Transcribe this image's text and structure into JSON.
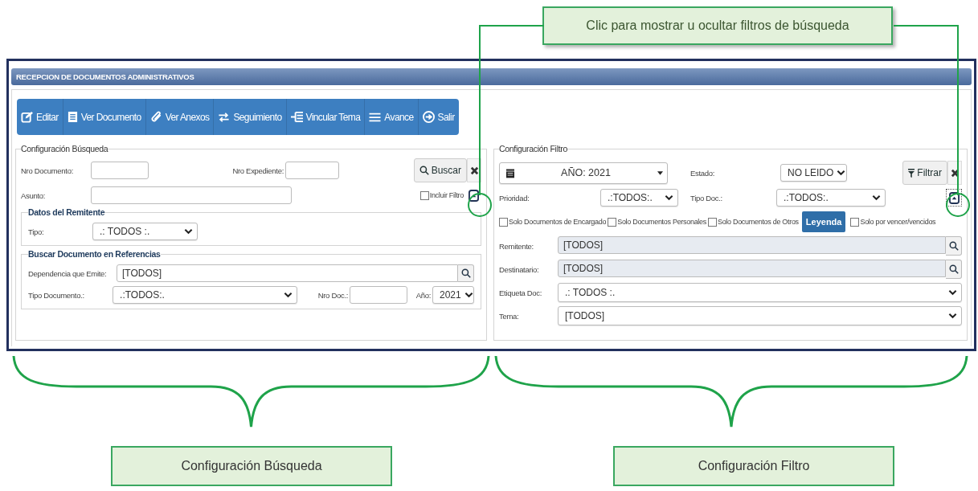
{
  "callout": {
    "text": "Clic para mostrar u ocultar filtros de búsqueda"
  },
  "window": {
    "title": "RECEPCION DE DOCUMENTOS ADMINISTRATIVOS"
  },
  "toolbar": [
    {
      "kind": "edit",
      "label": "Editar"
    },
    {
      "kind": "document",
      "label": "Ver Documento"
    },
    {
      "kind": "paperclip",
      "label": "Ver Anexos"
    },
    {
      "kind": "swap",
      "label": "Seguimiento"
    },
    {
      "kind": "link",
      "label": "Vincular Tema"
    },
    {
      "kind": "list",
      "label": "Avance"
    },
    {
      "kind": "exit",
      "label": "Salir"
    }
  ],
  "search_panel": {
    "legend": "Configuración Búsqueda",
    "nro_documento": {
      "label": "Nro Documento:"
    },
    "nro_expediente": {
      "label": "Nro Expediente:"
    },
    "search_button": {
      "label": "Buscar"
    },
    "asunto": {
      "label": "Asunto:"
    },
    "incluir_filtro": {
      "label": "Incluir Filtro",
      "checked": false
    },
    "remitente_group": {
      "legend": "Datos del Remitente",
      "tipo": {
        "label": "Tipo:",
        "value": ".: TODOS :."
      }
    },
    "referencias_group": {
      "legend": "Buscar Documento en Referencias",
      "dependencia": {
        "label": "Dependencia que Emite:",
        "value": "[TODOS]"
      },
      "tipo_documento": {
        "label": "Tipo Documento.:",
        "value": ".:TODOS:."
      },
      "nro_doc": {
        "label": "Nro Doc.:"
      },
      "anio": {
        "label": "Año:",
        "value": "2021"
      }
    }
  },
  "filter_panel": {
    "legend": "Configuración Filtro",
    "year": {
      "value": "AÑO: 2021"
    },
    "estado": {
      "label": "Estado:",
      "value": "NO LEIDO"
    },
    "filter_button": {
      "label": "Filtrar"
    },
    "prioridad": {
      "label": "Prioridad:",
      "value": ".:TODOS:."
    },
    "tipo_doc": {
      "label": "Tipo Doc.:",
      "value": ".:TODOS:."
    },
    "options": [
      {
        "label": "Solo Documentos de Encargado",
        "checked": false
      },
      {
        "label": "Solo Documentos Personales",
        "checked": false
      },
      {
        "label": "Solo Documentos de Otros",
        "checked": false
      }
    ],
    "legend_button": {
      "label": "Leyenda"
    },
    "vencer": {
      "label": "Solo por vencer/vencidos",
      "checked": false
    },
    "remitente": {
      "label": "Remitente:",
      "value": "[TODOS]"
    },
    "destinatario": {
      "label": "Destinatario:",
      "value": "[TODOS]"
    },
    "etiqueta": {
      "label": "Etiqueta Doc:",
      "value": ".: TODOS :."
    },
    "tema": {
      "label": "Tema:",
      "value": "[TODOS]"
    }
  },
  "annotations": {
    "left": "Configuración Búsqueda",
    "right": "Configuración Filtro"
  }
}
